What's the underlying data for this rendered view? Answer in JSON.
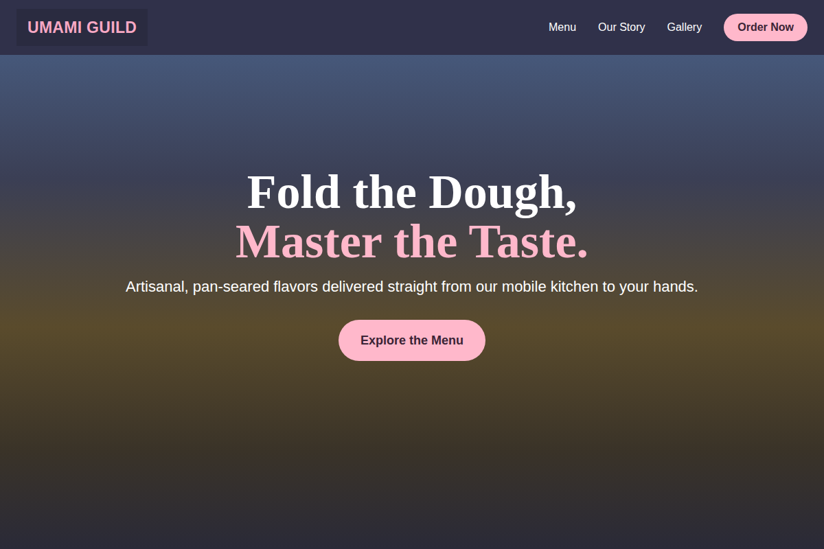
{
  "header": {
    "logo": "UMAMI GUILD",
    "links": [
      {
        "label": "Menu"
      },
      {
        "label": "Our Story"
      },
      {
        "label": "Gallery"
      }
    ],
    "cta": "Order Now"
  },
  "hero": {
    "title_line1": "Fold the Dough,",
    "title_line2": "Master the Taste.",
    "subtitle": "Artisanal, pan-seared flavors delivered straight from our mobile kitchen to your hands.",
    "button": "Explore the Menu"
  }
}
